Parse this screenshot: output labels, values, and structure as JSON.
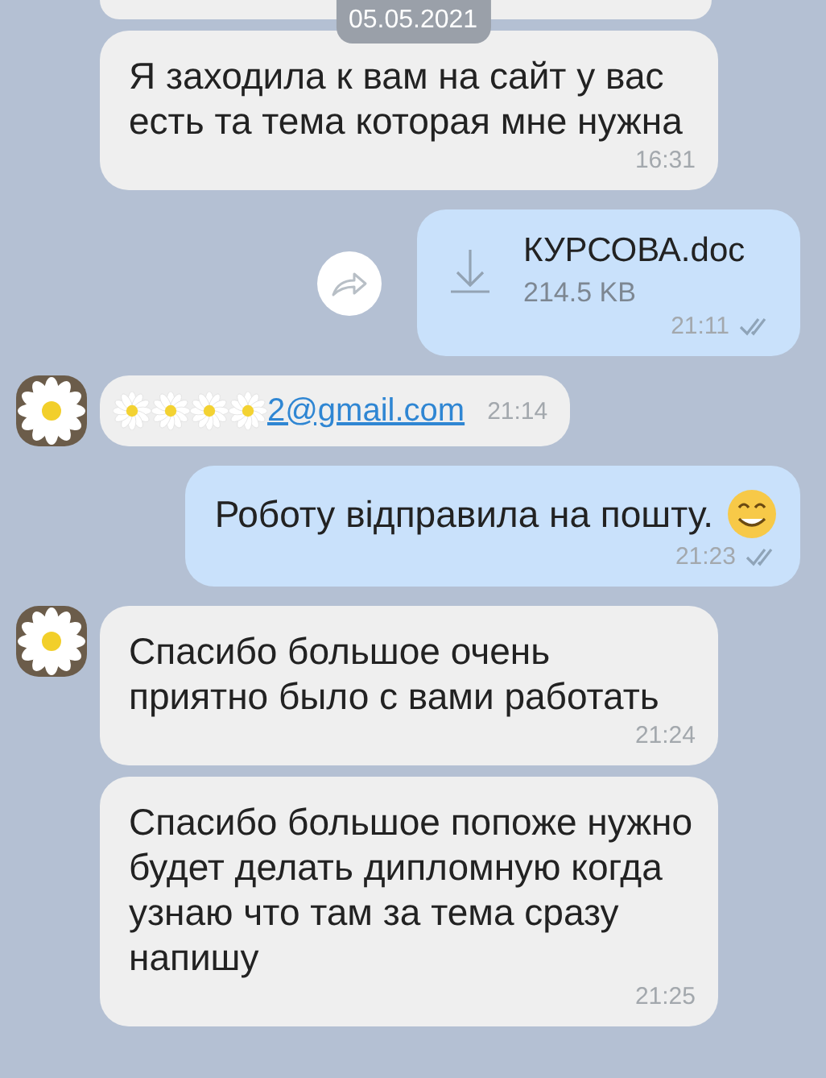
{
  "date_label": "05.05.2021",
  "messages": [
    {
      "kind": "text",
      "outgoing": false,
      "avatar": false,
      "text": "Я заходила к вам на сайт у вас есть та тема которая мне нужна",
      "time": "16:31"
    },
    {
      "kind": "file",
      "outgoing": true,
      "file_name": "КУРСОВА.doc",
      "file_size": "214.5 KB",
      "time": "21:11",
      "read": true,
      "share": true
    },
    {
      "kind": "link",
      "outgoing": false,
      "avatar": true,
      "link": "2@gmail.com",
      "time": "21:14"
    },
    {
      "kind": "text",
      "outgoing": true,
      "text": "Роботу відправила на пошту.",
      "emoji": true,
      "time": "21:23",
      "read": true
    },
    {
      "kind": "text",
      "outgoing": false,
      "avatar": true,
      "text": "Спасибо большое очень приятно было с вами работать",
      "time": "21:24"
    },
    {
      "kind": "text",
      "outgoing": false,
      "avatar": false,
      "text": "Спасибо большое попоже нужно будет делать дипломную когда узнаю что там за тема сразу напишу",
      "time": "21:25"
    }
  ]
}
